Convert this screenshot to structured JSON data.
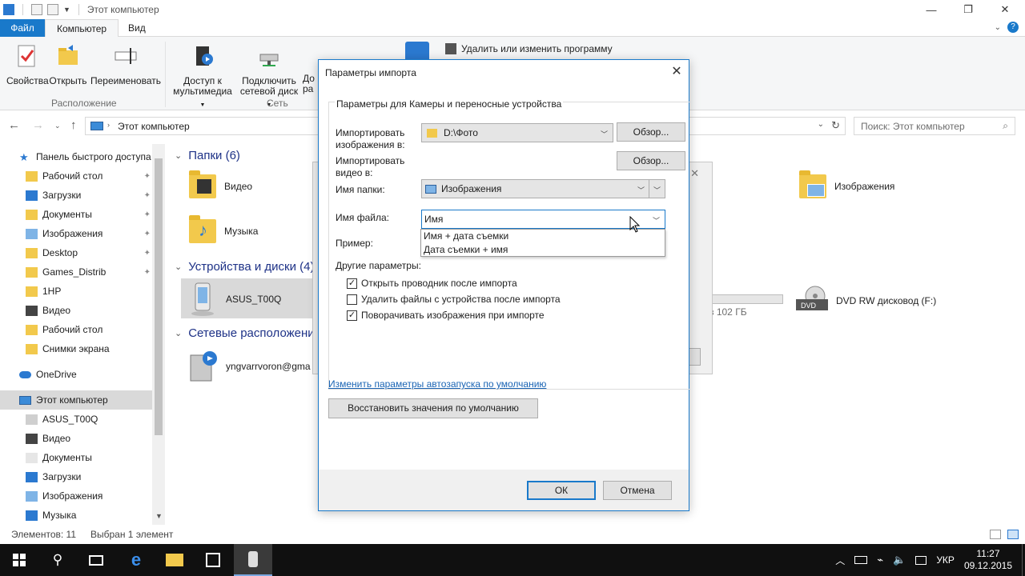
{
  "explorer": {
    "title": "Этот компьютер",
    "tabs": {
      "file": "Файл",
      "computer": "Компьютер",
      "view": "Вид"
    },
    "ribbon": {
      "properties": "Свойства",
      "open": "Открыть",
      "rename": "Переименовать",
      "media_access_1": "Доступ к",
      "media_access_2": "мультимедиа",
      "map_drive_1": "Подключить",
      "map_drive_2": "сетевой диск",
      "add_partial_1": "До",
      "add_partial_2": "ра",
      "uninstall": "Удалить или изменить программу",
      "group_location": "Расположение",
      "group_network": "Сеть"
    },
    "address": "Этот компьютер",
    "search_placeholder": "Поиск: Этот компьютер",
    "nav": {
      "quick_access": "Панель быстрого доступа",
      "items_quick": [
        "Рабочий стол",
        "Загрузки",
        "Документы",
        "Изображения",
        "Desktop",
        "Games_Distrib",
        "1HP",
        "Видео",
        "Рабочий стол",
        "Снимки экрана"
      ],
      "onedrive": "OneDrive",
      "this_pc": "Этот компьютер",
      "items_pc": [
        "ASUS_T00Q",
        "Видео",
        "Документы",
        "Загрузки",
        "Изображения",
        "Музыка"
      ]
    },
    "content": {
      "folders_header": "Папки (6)",
      "folder_video": "Видео",
      "folder_music": "Музыка",
      "folder_images": "Изображения",
      "devices_header": "Устройства и диски (4)",
      "device_asus": "ASUS_T00Q",
      "drive_free_partial": "з 102 ГБ",
      "dvd": "DVD RW дисковод (F:)",
      "network_header": "Сетевые расположени",
      "network_item": "yngvarrvoron@gma"
    },
    "status": {
      "count": "Элементов: 11",
      "selected": "Выбран 1 элемент"
    }
  },
  "dialog": {
    "title": "Параметры импорта",
    "group_label": "Параметры для Камеры и переносные устройства",
    "import_images_label": "Импортировать изображения в:",
    "import_images_value": "D:\\Фото",
    "browse": "Обзор...",
    "import_video_label": "Импортировать видео в:",
    "folder_name_label": "Имя папки:",
    "folder_name_value": "Изображения",
    "file_name_label": "Имя файла:",
    "file_name_value": "Имя",
    "dropdown_options": [
      "Имя + дата съемки",
      "Дата съемки + имя"
    ],
    "example_label": "Пример:",
    "other_label": "Другие параметры:",
    "checkboxes": [
      {
        "label": "Открыть проводник после импорта",
        "checked": true
      },
      {
        "label": "Удалить файлы с устройства после импорта",
        "checked": false
      },
      {
        "label": "Поворачивать изображения при импорте",
        "checked": true
      }
    ],
    "autoplay_link": "Изменить параметры автозапуска по умолчанию",
    "restore_defaults": "Восстановить значения по умолчанию",
    "ok": "ОК",
    "cancel": "Отмена"
  },
  "taskbar": {
    "lang": "УКР",
    "time": "11:27",
    "date": "09.12.2015"
  },
  "colors": {
    "accent": "#1979ca",
    "link": "#1a64b4",
    "section_header": "#1e3287"
  }
}
